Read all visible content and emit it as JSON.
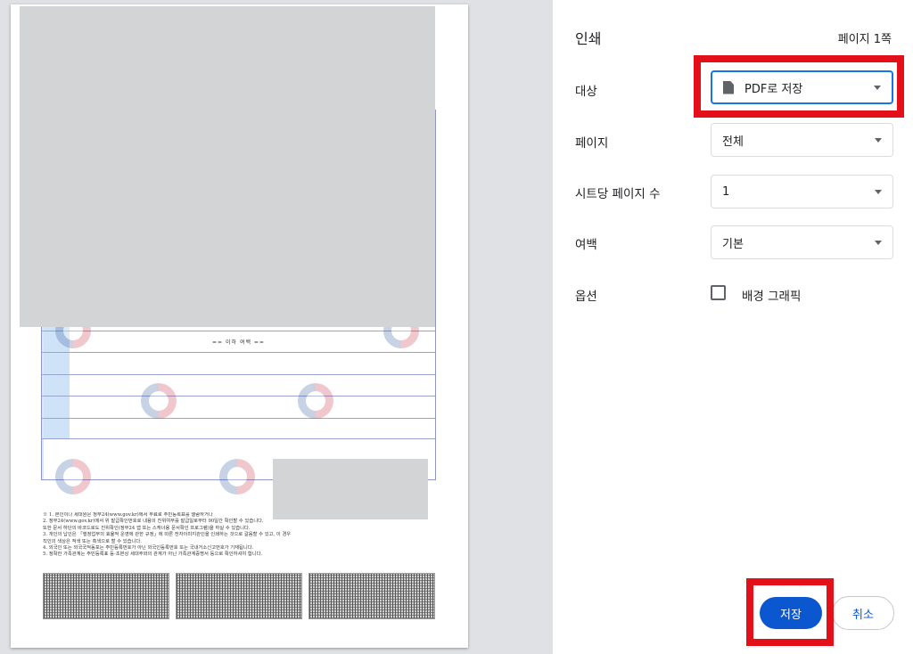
{
  "panel": {
    "title": "인쇄",
    "page_count": "페이지 1쪽"
  },
  "destination": {
    "label": "대상",
    "value": "PDF로 저장",
    "icon": "pdf-file-icon"
  },
  "pages": {
    "label": "페이지",
    "value": "전체"
  },
  "pages_per_sheet": {
    "label": "시트당 페이지 수",
    "value": "1"
  },
  "margins": {
    "label": "여백",
    "value": "기본"
  },
  "options": {
    "label": "옵션",
    "background_graphics": "배경 그래픽",
    "background_graphics_checked": false
  },
  "buttons": {
    "save": "저장",
    "cancel": "취소"
  },
  "preview": {
    "no_more_text": "== 이하 여백 ==",
    "notes": [
      "※ 1. 본인이나 세대원은 정부24(www.gov.kr)에서 무료로 주민등록표를 열람하거나",
      "   2. 정부24(www.gov.kr)에서 위 발급확인번호로 내용의 진위여부를 발급일로부터 90일간 확인할 수 있습니다.",
      "      또한 문서 하단의 바코드로도 진위확인(정부24 앱 또는 스캐너용 문서확인 프로그램)을 하실 수 있습니다.",
      "   3. 개인의 납인은 「행정업무의 효율적 운영에 관한 규정」에 따른 전자이미지관인을 인쇄하는 것으로 갈음할 수 있고, 이 경우",
      "      직인의 색상은 적색 또는 흑색으로 할 수 있습니다.",
      "   4. 외국인 또는 외국국적동포는 주민등록번호가 아닌 외국인등록번호 또는 국내거소신고번호가 기재됩니다.",
      "   5. 정확한 가족관계는 주민등록표 등·초본상 세대주와의 관계가 아닌 가족관계증명서 등으로 확인하셔야 합니다."
    ]
  },
  "colors": {
    "accent": "#0b57d0",
    "highlight": "#e3101a",
    "focus": "#1a73e8"
  }
}
